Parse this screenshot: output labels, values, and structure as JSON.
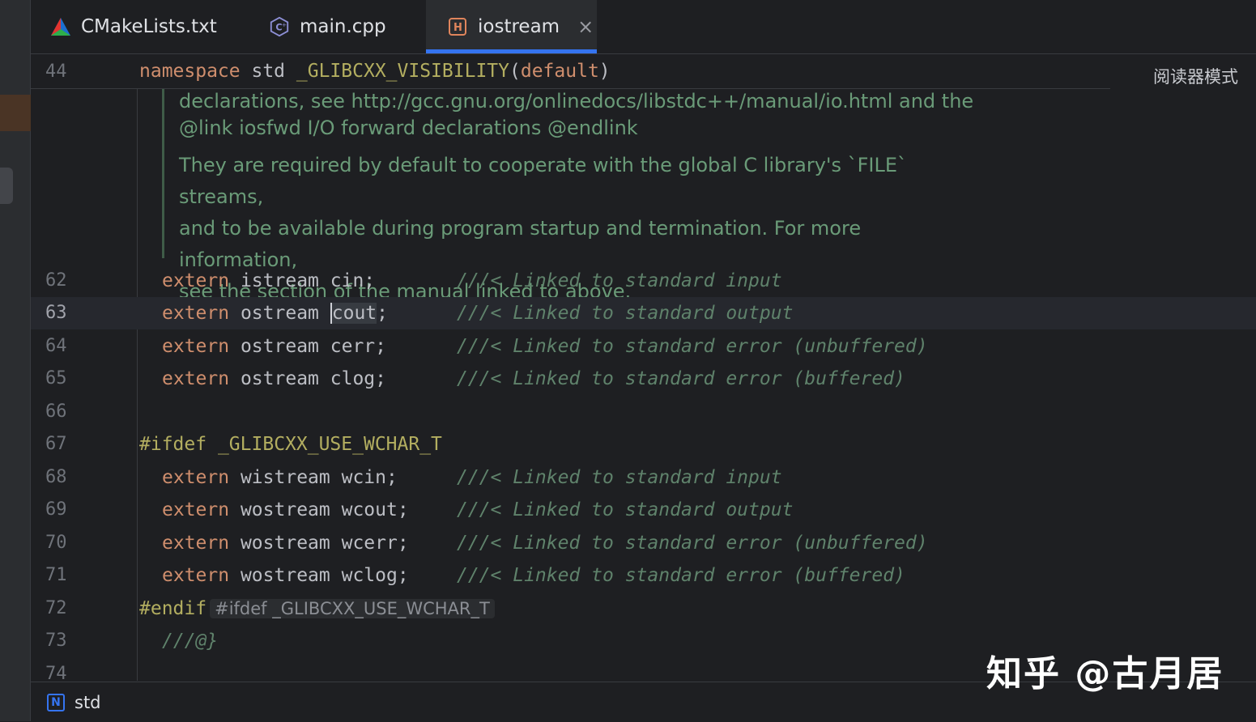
{
  "tabs": [
    {
      "label": "CMakeLists.txt",
      "icon": "cmake-icon",
      "active": false
    },
    {
      "label": "main.cpp",
      "icon": "cpp-file-icon",
      "active": false
    },
    {
      "label": "iostream",
      "icon": "header-file-icon",
      "active": true
    }
  ],
  "tab_close": "×",
  "reader_mode": "阅读器模式",
  "sticky": {
    "line": "44"
  },
  "doc_comment": {
    "line1": "declarations, see http://gcc.gnu.org/onlinedocs/libstdc++/manual/io.html and the",
    "line2": "@link iosfwd I/O forward declarations @endlink",
    "line3": "They are required by default to cooperate with the global C library's `FILE` streams,",
    "line4": "and to be available during program startup and termination. For more information,",
    "line5": "see the section of the manual linked to above."
  },
  "lines": {
    "l62": {
      "num": "62",
      "type": "istream",
      "name": "cin",
      "comment": "///< Linked to standard input"
    },
    "l63": {
      "num": "63",
      "type": "ostream",
      "name": "cout",
      "comment": "///< Linked to standard output"
    },
    "l64": {
      "num": "64",
      "type": "ostream",
      "name": "cerr",
      "comment": "///< Linked to standard error (unbuffered)"
    },
    "l65": {
      "num": "65",
      "type": "ostream",
      "name": "clog",
      "comment": "///< Linked to standard error (buffered)"
    },
    "l66": {
      "num": "66"
    },
    "l67": {
      "num": "67",
      "directive": "#ifdef",
      "macro": "_GLIBCXX_USE_WCHAR_T"
    },
    "l68": {
      "num": "68",
      "type": "wistream",
      "name": "wcin",
      "comment": "///< Linked to standard input"
    },
    "l69": {
      "num": "69",
      "type": "wostream",
      "name": "wcout",
      "comment": "///< Linked to standard output"
    },
    "l70": {
      "num": "70",
      "type": "wostream",
      "name": "wcerr",
      "comment": "///< Linked to standard error (unbuffered)"
    },
    "l71": {
      "num": "71",
      "type": "wostream",
      "name": "wclog",
      "comment": "///< Linked to standard error (buffered)"
    },
    "l72": {
      "num": "72",
      "directive": "#endif",
      "hint": "#ifdef _GLIBCXX_USE_WCHAR_T"
    },
    "l73": {
      "num": "73",
      "text": "///@}"
    },
    "l74": {
      "num": "74"
    }
  },
  "keyword_extern": "extern",
  "semicolon": ";",
  "status": {
    "icon": "namespace-icon",
    "icon_letter": "N",
    "text": "std"
  },
  "watermark": "知乎 @古月居"
}
